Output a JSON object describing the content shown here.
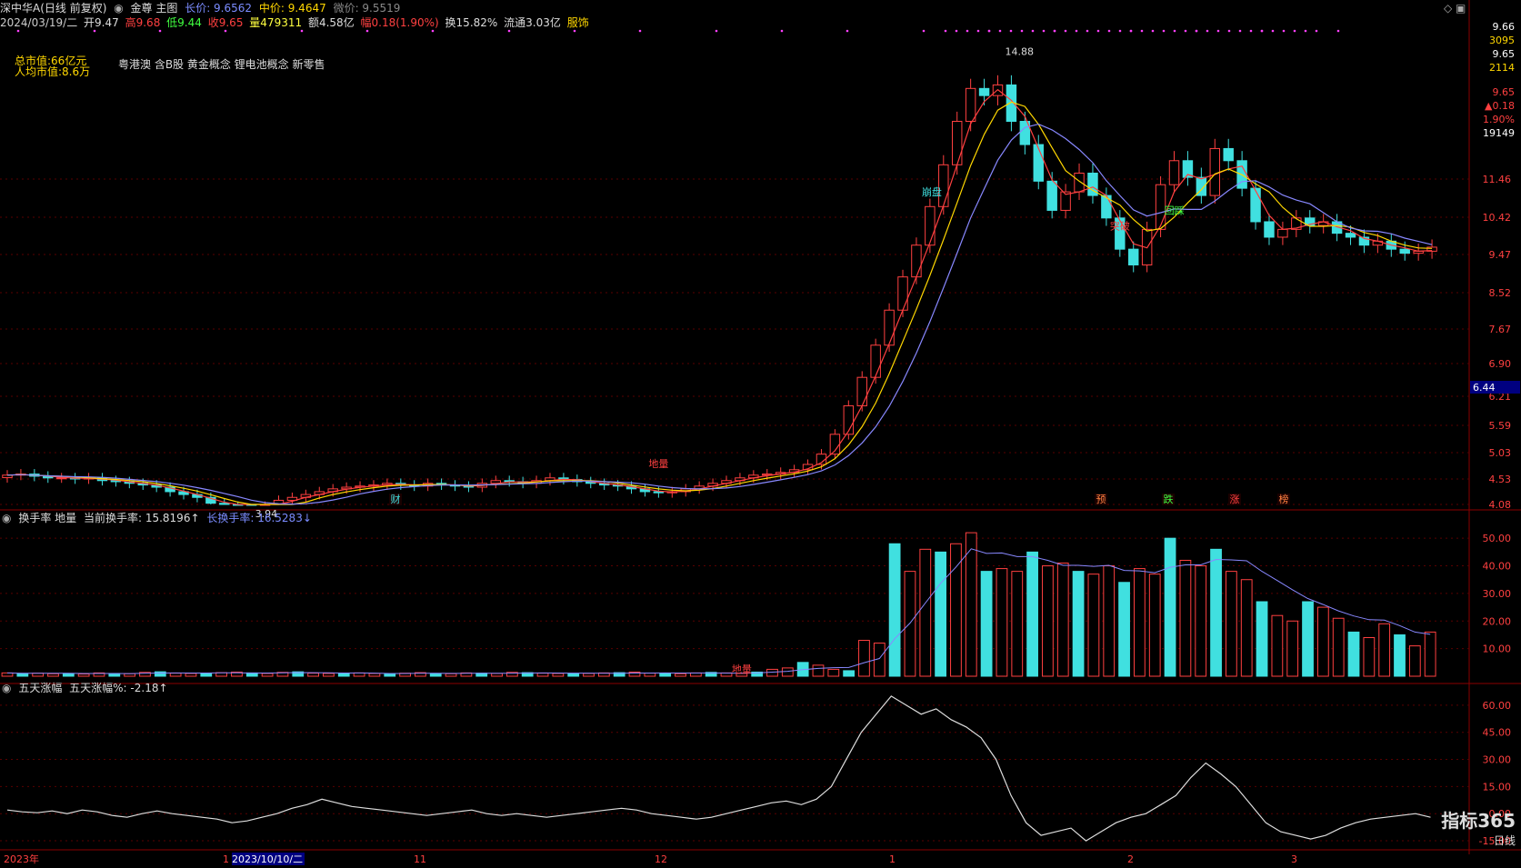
{
  "header": {
    "stock": "深中华A(日线 前复权)",
    "gold_label": "金尊 主图",
    "long_price_label": "长价: 9.6562",
    "mid_price_label": "中价: 9.4647",
    "micro_price_label": "微价: 9.5519",
    "date": "2024/03/19/二",
    "open": "开9.47",
    "high": "高9.68",
    "low": "低9.44",
    "close": "收9.65",
    "volume": "量479311",
    "amount": "额4.58亿",
    "change": "幅0.18(1.90%)",
    "turnover": "换15.82%",
    "float_cap": "流通3.03亿",
    "industry": "服饰"
  },
  "info": {
    "total_cap": "总市值:66亿元",
    "avg_cap": "人均市值:8.6万",
    "concepts": "粤港澳 含B股 黄金概念 锂电池概念 新零售"
  },
  "right_panel": {
    "p1": "9.66",
    "v1": "3095",
    "p2": "9.65",
    "v2": "2114",
    "p3": "9.65",
    "chg": "▲0.18",
    "pct": "1.90%",
    "vol": "19149"
  },
  "price_pane": {
    "ticks": [
      "11.46",
      "10.42",
      "9.47",
      "8.52",
      "7.67",
      "6.90",
      "6.21",
      "5.59",
      "5.03",
      "4.53",
      "4.08"
    ],
    "cur_marker": "6.44",
    "high_label": "14.88",
    "low_label": "3.94",
    "annotations": {
      "bengpan": "崩盘",
      "huicai": "回踩",
      "tupo": "突破",
      "diliang": "地量"
    },
    "badges": [
      "财",
      "预",
      "跌",
      "涨",
      "榜"
    ]
  },
  "turnover_pane": {
    "title": "换手率 地量",
    "current": "当前换手率: 15.8196↑",
    "long": "长换手率: 16.5283↓",
    "ticks": [
      "50.00",
      "40.00",
      "30.00",
      "20.00",
      "10.00"
    ],
    "diliang": "地量"
  },
  "five_day_pane": {
    "title": "五天涨幅",
    "value": "五天涨幅%: -2.18↑",
    "ticks": [
      "60.00",
      "45.00",
      "30.00",
      "15.00",
      "0.00",
      "-15.00"
    ]
  },
  "time_axis": {
    "labels": [
      "2023年",
      "1",
      "2023/10/10/二",
      "11",
      "12",
      "1",
      "2",
      "3"
    ],
    "period": "日线"
  },
  "logo": "指标365",
  "chart_data": {
    "type": "candlestick",
    "series": [
      {
        "name": "K线",
        "close": [
          4.6,
          4.62,
          4.58,
          4.55,
          4.55,
          4.53,
          4.55,
          4.5,
          4.48,
          4.45,
          4.42,
          4.38,
          4.3,
          4.25,
          4.2,
          4.1,
          4.05,
          4.0,
          3.94,
          4.05,
          4.15,
          4.2,
          4.25,
          4.3,
          4.35,
          4.38,
          4.4,
          4.42,
          4.45,
          4.42,
          4.4,
          4.45,
          4.42,
          4.4,
          4.38,
          4.45,
          4.5,
          4.48,
          4.45,
          4.5,
          4.55,
          4.52,
          4.48,
          4.45,
          4.42,
          4.4,
          4.35,
          4.3,
          4.28,
          4.3,
          4.35,
          4.4,
          4.45,
          4.5,
          4.55,
          4.6,
          4.62,
          4.65,
          4.7,
          4.8,
          5.0,
          5.4,
          6.0,
          6.6,
          7.3,
          8.1,
          8.9,
          9.7,
          10.7,
          11.8,
          12.9,
          13.8,
          13.6,
          13.9,
          12.9,
          12.3,
          11.4,
          10.6,
          11.1,
          11.6,
          11.0,
          10.4,
          9.6,
          9.2,
          10.1,
          11.3,
          11.9,
          11.5,
          11.0,
          12.2,
          11.9,
          11.2,
          10.3,
          9.9,
          10.1,
          10.4,
          10.2,
          10.3,
          10.0,
          9.9,
          9.7,
          9.8,
          9.6,
          9.5,
          9.55,
          9.65
        ]
      }
    ],
    "turnover": [
      1.2,
      1.0,
      1.1,
      0.9,
      1.0,
      0.8,
      1.2,
      1.0,
      0.9,
      1.4,
      1.6,
      1.1,
      1.0,
      0.9,
      1.3,
      1.5,
      1.2,
      1.0,
      1.4,
      1.6,
      1.1,
      1.0,
      0.9,
      1.2,
      1.0,
      0.8,
      1.1,
      1.3,
      1.0,
      0.9,
      1.2,
      1.1,
      1.0,
      1.4,
      1.3,
      1.1,
      1.0,
      0.9,
      1.0,
      1.2,
      1.3,
      1.5,
      1.1,
      1.0,
      0.9,
      1.2,
      1.4,
      1.2,
      1.0,
      1.5,
      2.5,
      3.0,
      5.0,
      4.0,
      2.5,
      2.0,
      13.0,
      12.0,
      48.0,
      38.0,
      46.0,
      45.0,
      48.0,
      52.0,
      38.0,
      39.0,
      38.0,
      45.0,
      40.0,
      41.0,
      38.0,
      37.0,
      40.0,
      34.0,
      39.0,
      37.0,
      50.0,
      42.0,
      40.0,
      46.0,
      38.0,
      35.0,
      27.0,
      22.0,
      20.0,
      27.0,
      25.0,
      21.0,
      16.0,
      14.0,
      19.0,
      15.0,
      11.0,
      16.0
    ],
    "five_day_change": [
      2,
      1,
      0.5,
      1.5,
      0,
      2,
      1,
      -1,
      -2,
      0,
      1.5,
      0,
      -1,
      -2,
      -3,
      -5,
      -4,
      -2,
      0,
      3,
      5,
      8,
      6,
      4,
      3,
      2,
      1,
      0,
      -1,
      0,
      1,
      2,
      0,
      -1,
      0,
      -1,
      -2,
      -1,
      0,
      1,
      2,
      3,
      2,
      0,
      -1,
      -2,
      -3,
      -2,
      0,
      2,
      4,
      6,
      7,
      5,
      8,
      15,
      30,
      45,
      55,
      65,
      60,
      55,
      58,
      52,
      48,
      42,
      30,
      10,
      -5,
      -12,
      -10,
      -8,
      -15,
      -10,
      -5,
      -2,
      0,
      5,
      10,
      20,
      28,
      22,
      15,
      5,
      -5,
      -10,
      -12,
      -14,
      -12,
      -8,
      -5,
      -3,
      -2,
      -1,
      0,
      -2
    ]
  }
}
